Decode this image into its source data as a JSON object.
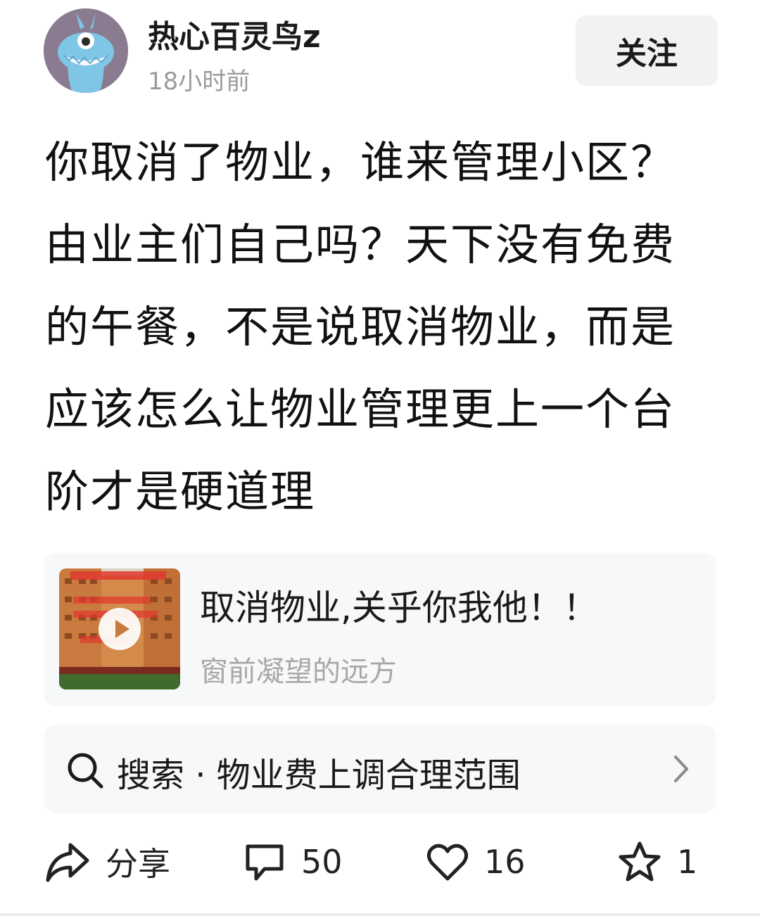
{
  "header": {
    "author_name": "热心百灵鸟z",
    "post_time": "18小时前",
    "follow_label": "关注"
  },
  "post": {
    "text": "你取消了物业，谁来管理小区？由业主们自己吗？天下没有免费的午餐，不是说取消物业，而是应该怎么让物业管理更上一个台阶才是硬道理"
  },
  "link_card": {
    "title": "取消物业,关乎你我他！！",
    "author": "窗前凝望的远方",
    "thumbnail_icon": "video-play-icon"
  },
  "search": {
    "icon": "search-icon",
    "text": "搜索 · 物业费上调合理范围"
  },
  "actions": {
    "share_label": "分享",
    "comment_count": "50",
    "like_count": "16",
    "favorite_count": "1"
  }
}
